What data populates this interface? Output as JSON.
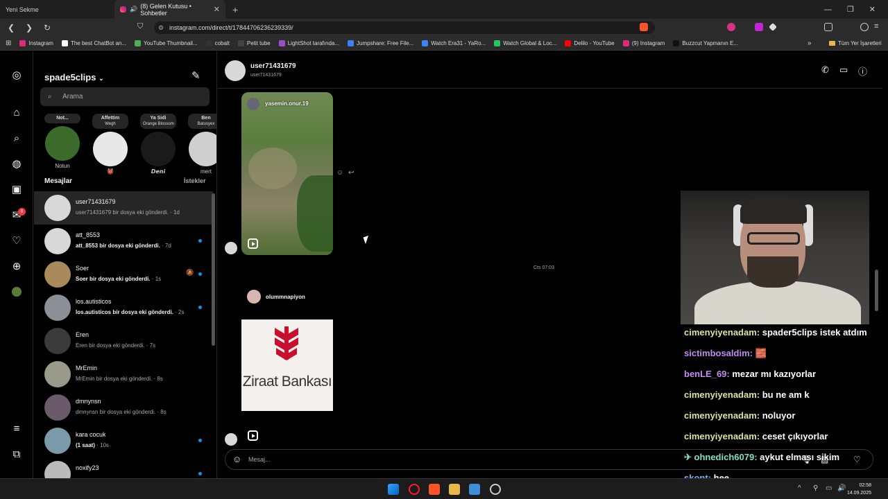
{
  "browser": {
    "tabs": [
      {
        "title": "Yeni Sekme",
        "active": false
      },
      {
        "title": "(8) Gelen Kutusu • Sohbetler",
        "active": true
      }
    ],
    "url": "instagram.com/direct/t/17844706236239339/",
    "bookmarks": [
      {
        "label": "Instagram",
        "color": "#dd2a7b"
      },
      {
        "label": "The best ChatBot an...",
        "color": "#ffffff"
      },
      {
        "label": "YouTube Thumbnail...",
        "color": "#4caf50"
      },
      {
        "label": "cobalt",
        "color": "#333333"
      },
      {
        "label": "Petit tube",
        "color": "#444444"
      },
      {
        "label": "LightShot tarafında...",
        "color": "#9c4dcc"
      },
      {
        "label": "Jumpshare: Free File...",
        "color": "#3b82f6"
      },
      {
        "label": "Watch Era31 - YaRo...",
        "color": "#3b82f6"
      },
      {
        "label": "Watch Global & Loc...",
        "color": "#22c55e"
      },
      {
        "label": "Delilo - YouTube",
        "color": "#ff0000"
      },
      {
        "label": "(9) Instagram",
        "color": "#dd2a7b"
      },
      {
        "label": "Buzzcut Yapmanın E...",
        "color": "#111111"
      }
    ],
    "all_bookmarks": "Tüm Yer İşaretleri"
  },
  "sidebar": {
    "notification_count": "8"
  },
  "inbox": {
    "username": "spade5clips",
    "search_placeholder": "Arama",
    "notes": [
      {
        "bubble_title": "Not...",
        "bubble_sub": "",
        "caption": "Notun",
        "color": "#3a6b2a"
      },
      {
        "bubble_title": "Affettim",
        "bubble_sub": "Wegh",
        "caption": "👹",
        "color": "#e8e8e8"
      },
      {
        "bubble_title": "Ya Sidi",
        "bubble_sub": "Orange Blossom",
        "caption": "𝘿𝙚𝙣𝙞",
        "color": "#1a1a1a"
      },
      {
        "bubble_title": "Ben",
        "bubble_sub": "Batusyex",
        "caption": "mert",
        "color": "#cfcfcf"
      }
    ],
    "messages_label": "Mesajlar",
    "requests_label": "İstekler",
    "conversations": [
      {
        "name": "user71431679",
        "preview": "user71431679 bir dosya eki gönderdi.",
        "time": "1d",
        "unread": false,
        "active": true,
        "color": "#d8d8d8"
      },
      {
        "name": "att_8553",
        "preview": "att_8553 bir dosya eki gönderdi.",
        "time": "7d",
        "unread": true,
        "active": false,
        "color": "#d8d8d8"
      },
      {
        "name": "Soer",
        "preview": "Soer bir dosya eki gönderdi.",
        "time": "1s",
        "unread": true,
        "active": false,
        "muted": true,
        "color": "#a88a5c"
      },
      {
        "name": "los.autisticos",
        "preview": "los.autisticos bir dosya eki gönderdi.",
        "time": "2s",
        "unread": true,
        "active": false,
        "color": "#8b8f96"
      },
      {
        "name": "Eren",
        "preview": "Eren bir dosya eki gönderdi.",
        "time": "7s",
        "unread": false,
        "active": false,
        "color": "#3a3a3a"
      },
      {
        "name": "MrEmin",
        "preview": "MrEmin bir dosya eki gönderdi.",
        "time": "8s",
        "unread": false,
        "active": false,
        "color": "#9a9a8a"
      },
      {
        "name": "dmnynsn",
        "preview": "dmnynsn bir dosya eki gönderdi.",
        "time": "8s",
        "unread": false,
        "active": false,
        "color": "#6a5a6a"
      },
      {
        "name": "kara cocuk",
        "preview": "(1 saat)",
        "time": "10s",
        "unread": true,
        "active": false,
        "color": "#7a9aaa"
      },
      {
        "name": "noxify23",
        "preview": "",
        "time": "",
        "unread": true,
        "active": false,
        "color": "#bbbbbb"
      }
    ]
  },
  "chat": {
    "header_name": "user71431679",
    "header_sub": "user71431679",
    "reel_title": "yasemin.onur.19",
    "timestamp": "Cts 07:03",
    "share_user": "olummnapiyon",
    "share_text": "Ziraat Bankası",
    "composer_placeholder": "Mesaj..."
  },
  "stream_chat": [
    {
      "user": "cimenyiyenadam",
      "color": "#d6e8a0",
      "text": "spader5clips istek atdım"
    },
    {
      "user": "sictimbosaldim",
      "color": "#c08cf0",
      "text": "🧱"
    },
    {
      "user": "benLE_69",
      "color": "#c08cf0",
      "text": "mezar mı kazıyorlar"
    },
    {
      "user": "cimenyiyenadam",
      "color": "#d6e8a0",
      "text": "bu ne am k"
    },
    {
      "user": "cimenyiyenadam",
      "color": "#d6e8a0",
      "text": "noluyor"
    },
    {
      "user": "cimenyiyenadam",
      "color": "#d6e8a0",
      "text": "ceset çıkıyorlar"
    },
    {
      "user": "✈ ohnedich6079",
      "color": "#7fe0c8",
      "text": "aykut elması sikim"
    },
    {
      "user": "skont",
      "color": "#7fb0ff",
      "text": "hee"
    }
  ],
  "taskbar": {
    "time": "02:58",
    "date": "14.09.2025"
  }
}
